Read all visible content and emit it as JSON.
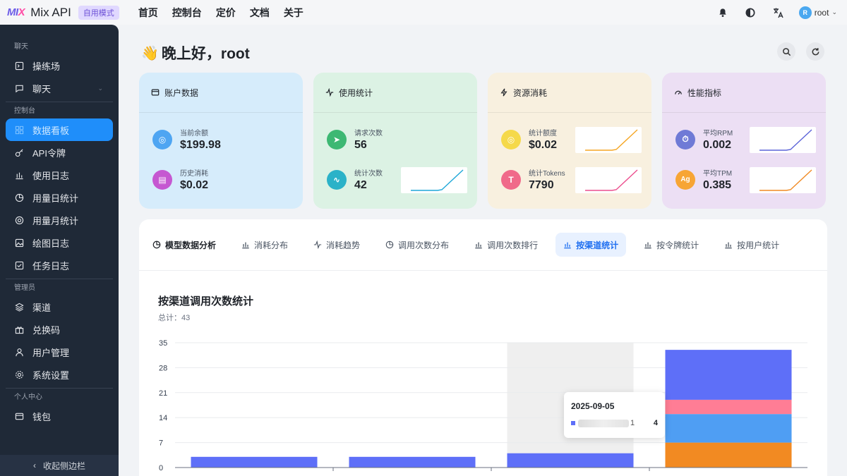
{
  "header": {
    "logo_text": "MIX",
    "app_title": "Mix API",
    "mode_badge": "自用模式",
    "nav": [
      "首页",
      "控制台",
      "定价",
      "文档",
      "关于"
    ],
    "user_initial": "R",
    "user_name": "root"
  },
  "sidebar": {
    "section_chat": "聊天",
    "playground": "操练场",
    "chat": "聊天",
    "section_console": "控制台",
    "dashboard": "数据看板",
    "api_tokens": "API令牌",
    "usage_log": "使用日志",
    "daily_stats": "用量日统计",
    "monthly_stats": "用量月统计",
    "drawing_log": "绘图日志",
    "task_log": "任务日志",
    "section_admin": "管理员",
    "channels": "渠道",
    "redeem_codes": "兑换码",
    "user_mgmt": "用户管理",
    "system_settings": "系统设置",
    "section_personal": "个人中心",
    "wallet": "钱包",
    "collapse": "收起侧边栏"
  },
  "greeting": "晚上好，root",
  "cards": {
    "account": {
      "title": "账户数据",
      "balance_label": "当前余额",
      "balance": "$199.98",
      "spent_label": "历史消耗",
      "spent": "$0.02"
    },
    "usage": {
      "title": "使用统计",
      "requests_label": "请求次数",
      "requests": "56",
      "stat_count_label": "统计次数",
      "stat_count": "42"
    },
    "resource": {
      "title": "资源消耗",
      "quota_label": "统计额度",
      "quota": "$0.02",
      "tokens_label": "统计Tokens",
      "tokens": "7790"
    },
    "perf": {
      "title": "性能指标",
      "rpm_label": "平均RPM",
      "rpm": "0.002",
      "tpm_label": "平均TPM",
      "tpm": "0.385"
    }
  },
  "tabs": [
    "模型数据分析",
    "消耗分布",
    "消耗趋势",
    "调用次数分布",
    "调用次数排行",
    "按渠道统计",
    "按令牌统计",
    "按用户统计"
  ],
  "active_tab": 5,
  "chart_panel": {
    "title": "按渠道调用次数统计",
    "total": "总计：43"
  },
  "tooltip": {
    "date": "2025-09-05",
    "value": "4",
    "suffix": "1"
  },
  "colors": {
    "accent": "#1f8efa",
    "bar_blue": "#5e6ff8",
    "bar_pink": "#ff7d95",
    "bar_sky": "#4f9ef3",
    "bar_orange": "#f28a22"
  },
  "chart_data": {
    "type": "bar",
    "stacked": true,
    "categories": [
      "",
      "",
      "2025-09-05",
      ""
    ],
    "series": [
      {
        "values": [
          0,
          0,
          0,
          7
        ]
      },
      {
        "values": [
          0,
          0,
          0,
          8
        ]
      },
      {
        "values": [
          0,
          0,
          0,
          4
        ]
      },
      {
        "values": [
          3,
          3,
          4,
          14
        ]
      }
    ],
    "series_colors": [
      "#f28a22",
      "#4f9ef3",
      "#ff7d95",
      "#5e6ff8"
    ],
    "yticks": [
      0,
      7,
      14,
      21,
      28,
      35
    ],
    "ylim": [
      0,
      35
    ],
    "highlight_index": 2
  }
}
